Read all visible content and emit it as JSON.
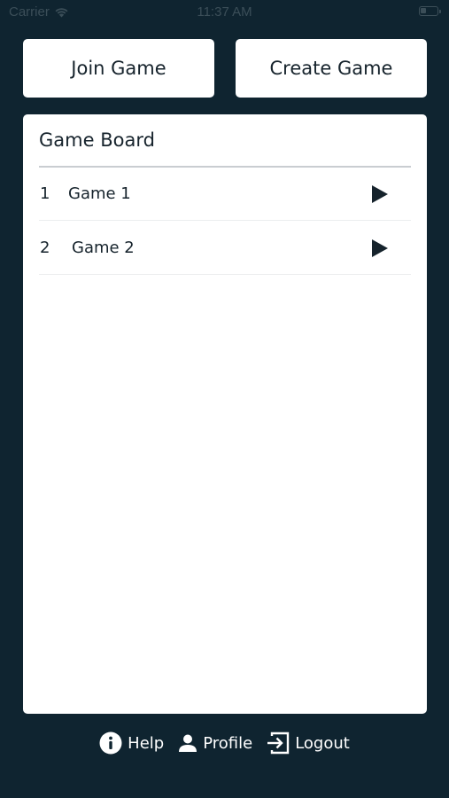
{
  "status_bar": {
    "carrier": "Carrier",
    "time": "11:37 AM",
    "battery_level": 0.35
  },
  "actions": {
    "join_label": "Join Game",
    "create_label": "Create Game"
  },
  "game_board": {
    "title": "Game Board",
    "games": [
      {
        "number": "1",
        "name": "Game 1",
        "icon": "play-icon"
      },
      {
        "number": "2",
        "name": "Game 2",
        "icon": "play-icon"
      }
    ]
  },
  "bottom_nav": {
    "help_label": "Help",
    "profile_label": "Profile",
    "logout_label": "Logout",
    "help_icon": "info-icon",
    "profile_icon": "user-icon",
    "logout_icon": "logout-icon"
  },
  "colors": {
    "background": "#0f2430",
    "card": "#ffffff",
    "text": "#16232c",
    "nav_text": "#ffffff"
  }
}
